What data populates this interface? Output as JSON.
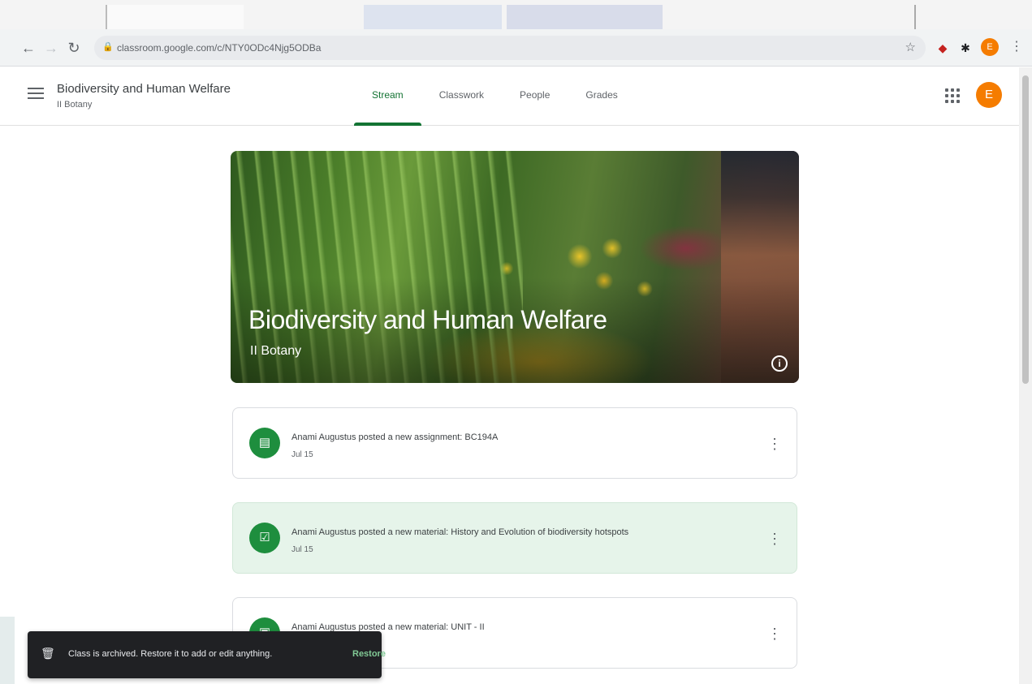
{
  "browser": {
    "url": "classroom.google.com/c/NTY0ODc4Njg5ODBa",
    "profile_initial": "E"
  },
  "header": {
    "class_title": "Biodiversity and Human Welfare",
    "class_subtitle": "II Botany",
    "tabs": [
      {
        "label": "Stream",
        "active": true
      },
      {
        "label": "Classwork",
        "active": false
      },
      {
        "label": "People",
        "active": false
      },
      {
        "label": "Grades",
        "active": false
      }
    ],
    "avatar_initial": "E"
  },
  "banner": {
    "title": "Biodiversity and Human Welfare",
    "subtitle": "II Botany",
    "info_icon": "info-icon"
  },
  "stream": [
    {
      "text": "Anami Augustus posted a new assignment: BC194A",
      "date": "Jul 15",
      "icon": "assignment-icon",
      "highlighted": false
    },
    {
      "text": "Anami Augustus posted a new material: History and Evolution of biodiversity hotspots",
      "date": "Jul 15",
      "icon": "material-icon",
      "highlighted": true
    },
    {
      "text": "Anami Augustus posted a new material: UNIT - II",
      "date": "",
      "icon": "material-icon",
      "highlighted": false
    }
  ],
  "snackbar": {
    "message": "Class is archived. Restore it to add or edit anything.",
    "action": "Restore"
  },
  "colors": {
    "accent": "#137333",
    "stream_icon": "#1e8e3e",
    "highlight_bg": "#e6f4ea",
    "avatar": "#f57c00"
  }
}
